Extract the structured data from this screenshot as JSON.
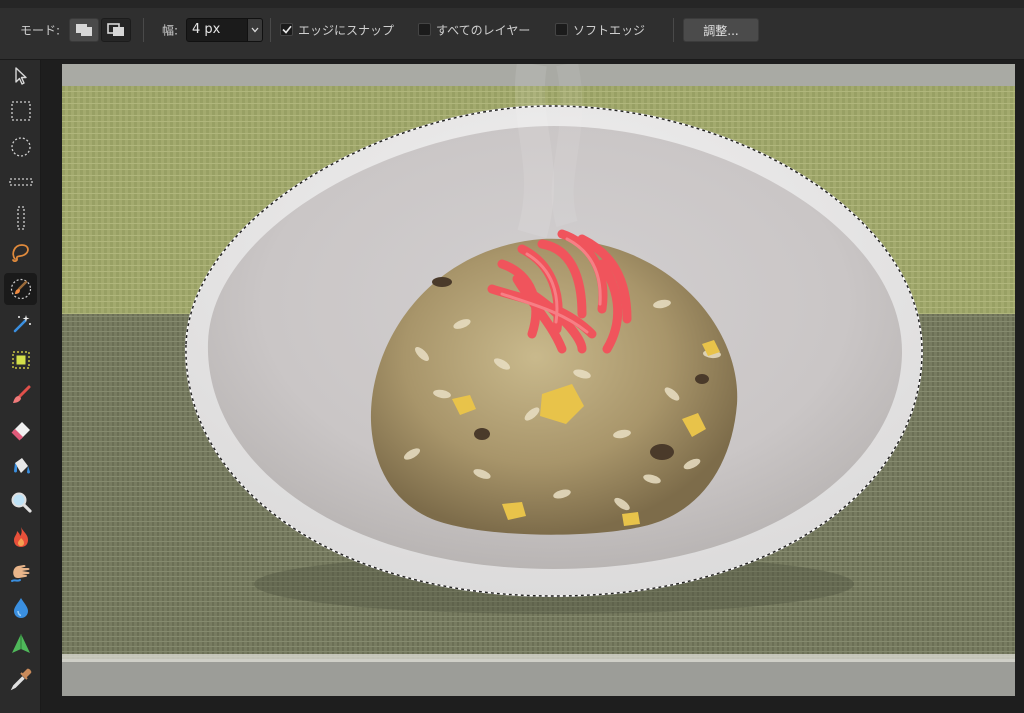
{
  "options_bar": {
    "mode_label": "モード:",
    "width_label": "幅:",
    "width_value": "4 px",
    "snap_edges_label": "エッジにスナップ",
    "snap_edges_checked": true,
    "all_layers_label": "すべてのレイヤー",
    "all_layers_checked": false,
    "soft_edge_label": "ソフトエッジ",
    "soft_edge_checked": false,
    "adjust_button_label": "調整..."
  },
  "tools": [
    {
      "icon": "move-arrow-icon"
    },
    {
      "icon": "rectangular-marquee-icon"
    },
    {
      "icon": "elliptical-marquee-icon"
    },
    {
      "icon": "single-row-marquee-icon"
    },
    {
      "icon": "single-column-marquee-icon"
    },
    {
      "icon": "freehand-lasso-icon"
    },
    {
      "icon": "selection-brush-icon",
      "active": true
    },
    {
      "icon": "magic-wand-icon"
    },
    {
      "icon": "flood-select-icon"
    },
    {
      "icon": "paint-brush-icon"
    },
    {
      "icon": "eraser-icon"
    },
    {
      "icon": "fill-bucket-icon"
    },
    {
      "icon": "zoom-icon"
    },
    {
      "icon": "burn-icon"
    },
    {
      "icon": "smudge-icon"
    },
    {
      "icon": "blur-drop-icon"
    },
    {
      "icon": "sharpen-icon"
    },
    {
      "icon": "color-picker-icon"
    }
  ],
  "colors": {
    "panel_bg": "#2f2f2f",
    "toolbar_bg": "#2b2b2b",
    "canvas_bg": "#1e1e1e",
    "tool_accent_orange": "#e08a3c",
    "tool_accent_red": "#e0504a",
    "tool_accent_blue": "#3a8fe0",
    "tool_accent_green": "#4fb85a",
    "placemat_light": "#a3aa6e",
    "placemat_dark": "#777b60",
    "garnish_red": "#f0545c"
  }
}
